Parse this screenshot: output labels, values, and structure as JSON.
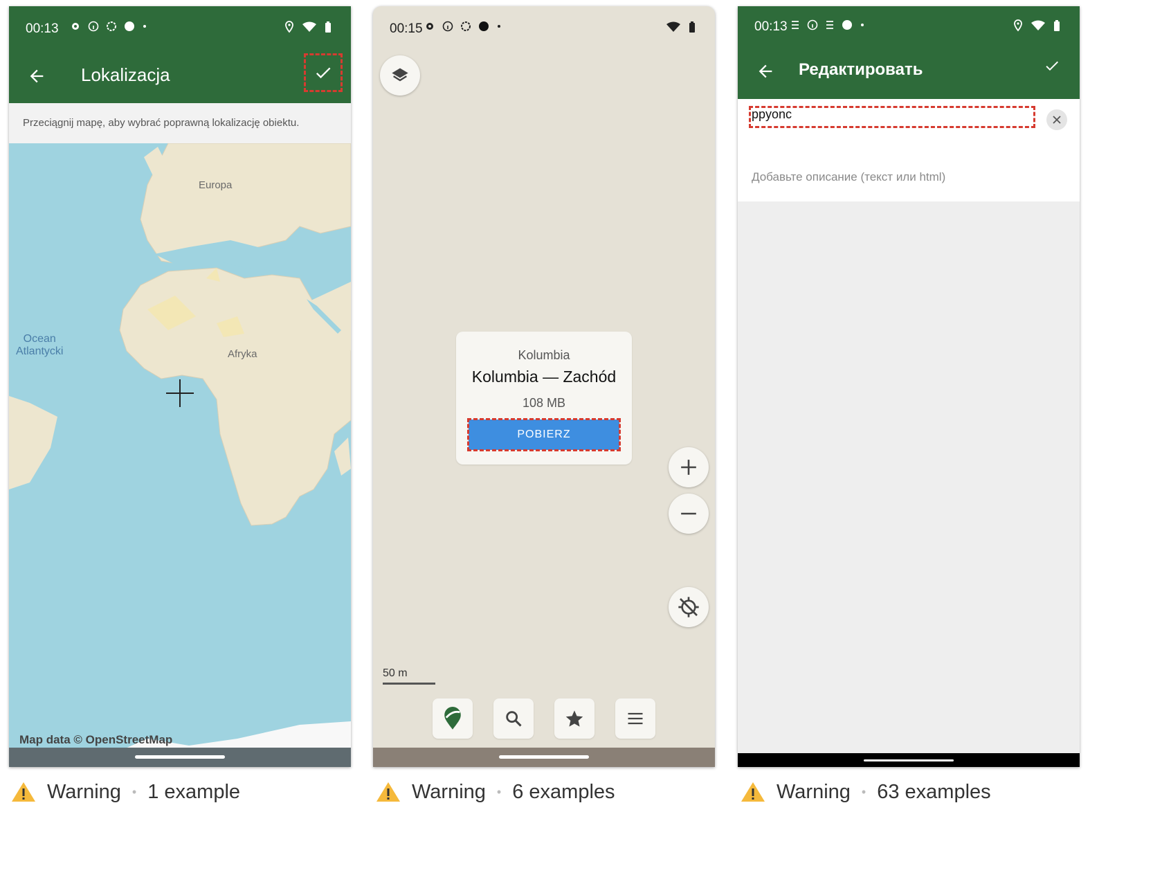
{
  "screens": [
    {
      "status_time": "00:13",
      "title": "Lokalizacja",
      "hint": "Przeciągnij mapę, aby wybrać poprawną lokalizację obiektu.",
      "map_labels": {
        "europe": "Europa",
        "africa": "Afryka",
        "ocean": "Ocean\nAtlantycki"
      },
      "credit": "Map data © OpenStreetMap"
    },
    {
      "status_time": "00:15",
      "card": {
        "country": "Kolumbia",
        "region": "Kolumbia — Zachód",
        "size": "108 MB",
        "button": "POBIERZ"
      },
      "scale": "50 m",
      "icons": [
        "layers-icon",
        "zoom-in-icon",
        "zoom-out-icon",
        "location-off-icon",
        "app-logo-icon",
        "search-icon",
        "star-icon",
        "menu-icon"
      ]
    },
    {
      "status_time": "00:13",
      "title": "Редактировать",
      "name_value": "ppyonc",
      "description_placeholder": "Добавьте описание (текст или html)"
    }
  ],
  "footers": [
    {
      "level": "Warning",
      "count": "1 example"
    },
    {
      "level": "Warning",
      "count": "6 examples"
    },
    {
      "level": "Warning",
      "count": "63 examples"
    }
  ],
  "colors": {
    "appbar": "#2e6b3a",
    "highlight": "#d63b30",
    "button": "#3e8ee0",
    "water": "#9fd3e0",
    "land": "#ede6cf"
  }
}
